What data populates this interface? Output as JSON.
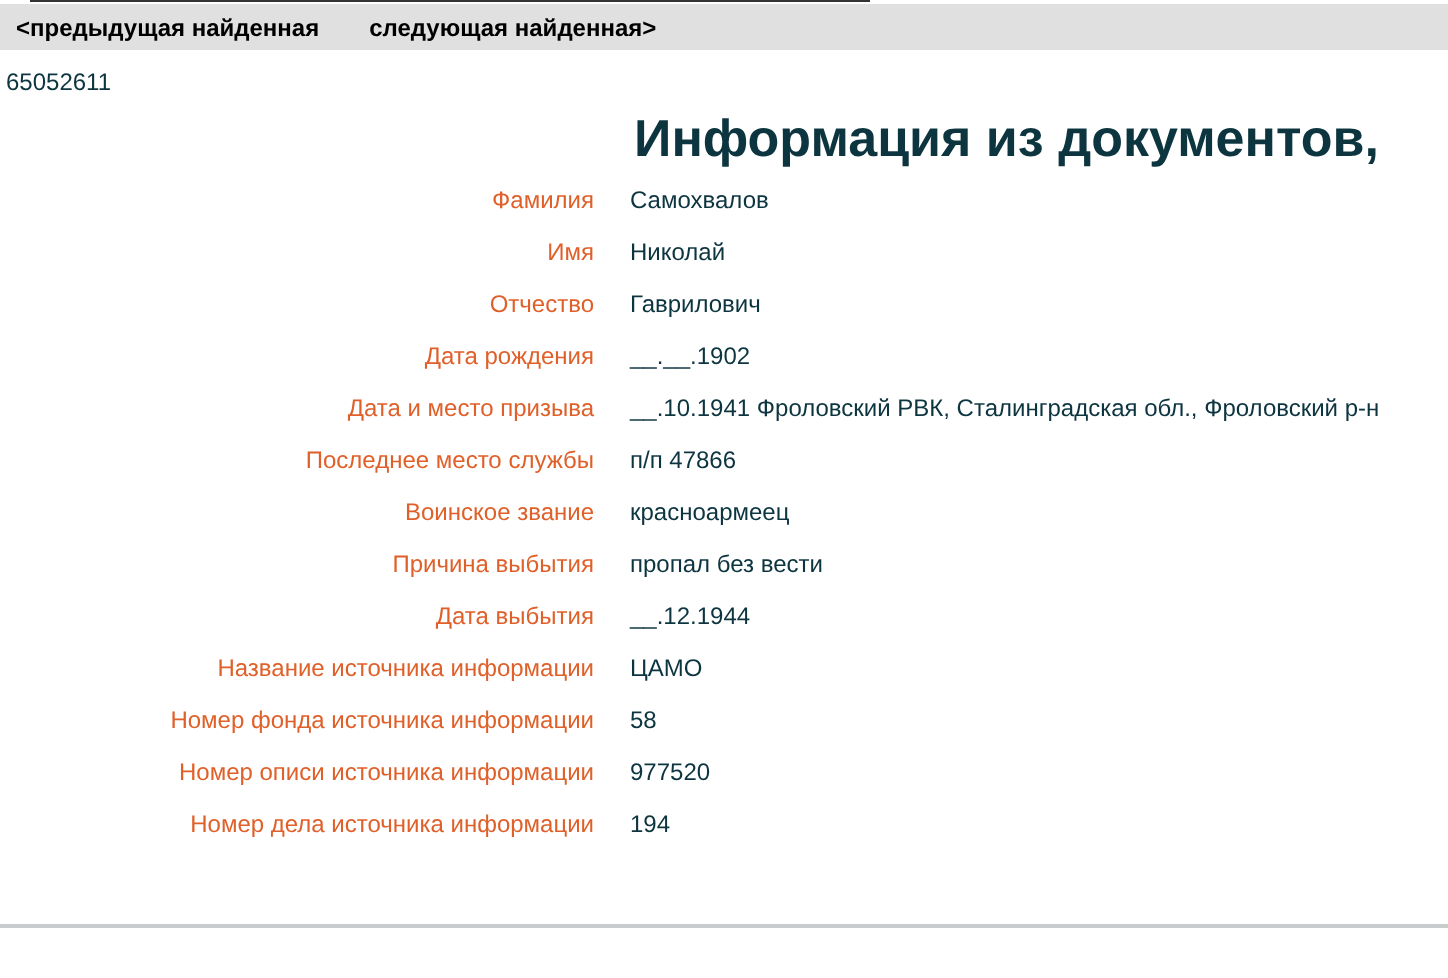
{
  "nav": [
    {
      "label": "<предыдущая найденная"
    },
    {
      "label": "следующая найденная>"
    }
  ],
  "record_id": "65052611",
  "title": "Информация из документов,",
  "fields": [
    {
      "label": "Фамилия",
      "value": "Самохвалов"
    },
    {
      "label": "Имя",
      "value": "Николай"
    },
    {
      "label": "Отчество",
      "value": "Гаврилович"
    },
    {
      "label": "Дата рождения",
      "value": "__.__.1902"
    },
    {
      "label": "Дата и место призыва",
      "value": "__.10.1941 Фроловский РВК, Сталинградская обл., Фроловский р-н"
    },
    {
      "label": "Последнее место службы",
      "value": "п/п 47866"
    },
    {
      "label": "Воинское звание",
      "value": "красноармеец"
    },
    {
      "label": "Причина выбытия",
      "value": "пропал без вести"
    },
    {
      "label": "Дата выбытия",
      "value": "__.12.1944"
    },
    {
      "label": "Название источника информации",
      "value": "ЦАМО"
    },
    {
      "label": "Номер фонда источника информации",
      "value": "58"
    },
    {
      "label": "Номер описи источника информации",
      "value": "977520"
    },
    {
      "label": "Номер дела источника информации",
      "value": "194"
    }
  ]
}
